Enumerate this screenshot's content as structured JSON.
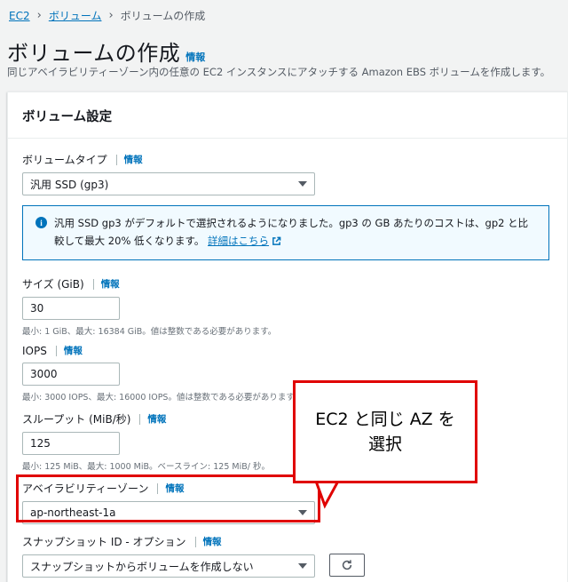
{
  "breadcrumb": {
    "items": [
      "EC2",
      "ボリューム"
    ],
    "current": "ボリュームの作成"
  },
  "page": {
    "title": "ボリュームの作成",
    "title_info": "情報",
    "description": "同じアベイラビリティーゾーン内の任意の EC2 インスタンスにアタッチする Amazon EBS ボリュームを作成します。"
  },
  "panel": {
    "title": "ボリューム設定"
  },
  "volume_type": {
    "label": "ボリュームタイプ",
    "info": "情報",
    "value": "汎用 SSD (gp3)"
  },
  "alert": {
    "text": "汎用 SSD gp3 がデフォルトで選択されるようになりました。gp3 の GB あたりのコストは、gp2 と比較して最大 20% 低くなります。",
    "link": "詳細はこちら"
  },
  "size": {
    "label": "サイズ (GiB)",
    "info": "情報",
    "value": "30",
    "hint": "最小: 1 GiB、最大: 16384 GiB。値は整数である必要があります。"
  },
  "iops": {
    "label": "IOPS",
    "info": "情報",
    "value": "3000",
    "hint": "最小: 3000 IOPS、最大: 16000 IOPS。値は整数である必要があります。"
  },
  "throughput": {
    "label": "スループット (MiB/秒)",
    "info": "情報",
    "value": "125",
    "hint": "最小: 125 MiB、最大: 1000 MiB。ベースライン: 125 MiB/ 秒。"
  },
  "availability_zone": {
    "label": "アベイラビリティーゾーン",
    "info": "情報",
    "value": "ap-northeast-1a"
  },
  "snapshot": {
    "label": "スナップショット ID - オプション",
    "info": "情報",
    "value": "スナップショットからボリュームを作成しない"
  },
  "annotation": {
    "line1": "EC2 と同じ AZ を",
    "line2": "選択",
    "color": "#e00000"
  },
  "icons": {
    "info": "info-circle-icon",
    "external": "external-link-icon",
    "refresh": "refresh-icon",
    "caret": "caret-down-icon"
  }
}
